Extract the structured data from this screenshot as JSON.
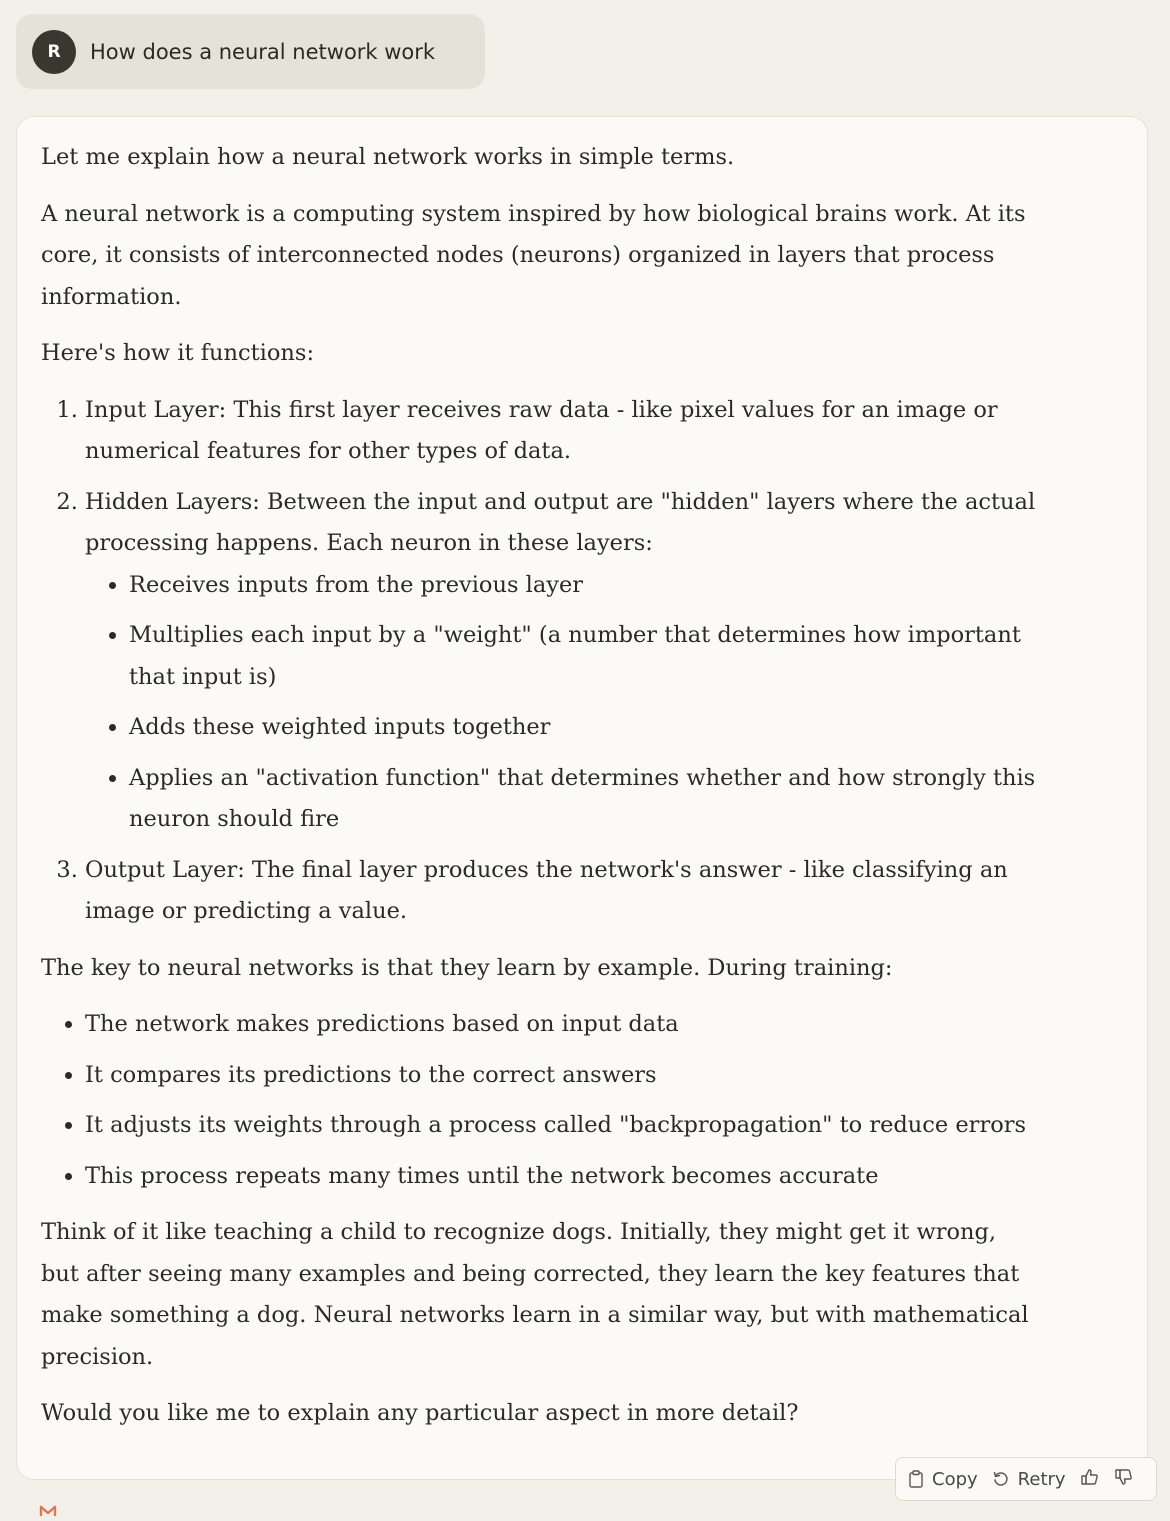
{
  "user_message": {
    "avatar_initial": "R",
    "text": "How does a neural network work"
  },
  "response": {
    "intro": "Let me explain how a neural network works in simple terms.",
    "definition": "A neural network is a computing system inspired by how biological brains work. At its core, it consists of interconnected nodes (neurons) organized in layers that process information.",
    "functions_heading": "Here's how it functions:",
    "steps": [
      {
        "text": "Input Layer: This first layer receives raw data - like pixel values for an image or numerical features for other types of data."
      },
      {
        "text": "Hidden Layers: Between the input and output are \"hidden\" layers where the actual processing happens. Each neuron in these layers:",
        "sub_items": [
          "Receives inputs from the previous layer",
          "Multiplies each input by a \"weight\" (a number that determines how important that input is)",
          "Adds these weighted inputs together",
          "Applies an \"activation function\" that determines whether and how strongly this neuron should fire"
        ]
      },
      {
        "text": "Output Layer: The final layer produces the network's answer - like classifying an image or predicting a value."
      }
    ],
    "training_intro": "The key to neural networks is that they learn by example. During training:",
    "training_items": [
      "The network makes predictions based on input data",
      "It compares its predictions to the correct answers",
      "It adjusts its weights through a process called \"backpropagation\" to reduce errors",
      "This process repeats many times until the network becomes accurate"
    ],
    "analogy": "Think of it like teaching a child to recognize dogs. Initially, they might get it wrong, but after seeing many examples and being corrected, they learn the key features that make something a dog. Neural networks learn in a similar way, but with mathematical precision.",
    "closing": "Would you like me to explain any particular aspect in more detail?"
  },
  "actions": {
    "copy_label": "Copy",
    "retry_label": "Retry",
    "copy_icon": "clipboard-icon",
    "retry_icon": "retry-icon",
    "thumbs_up_icon": "thumbs-up-icon",
    "thumbs_down_icon": "thumbs-down-icon"
  },
  "colors": {
    "page_background": "#f2f0e9",
    "user_bubble": "#e5e2d7",
    "avatar": "#3a372f",
    "card_background": "#fbfaf7",
    "text": "#2b2a27",
    "logo_accent": "#d97757"
  }
}
